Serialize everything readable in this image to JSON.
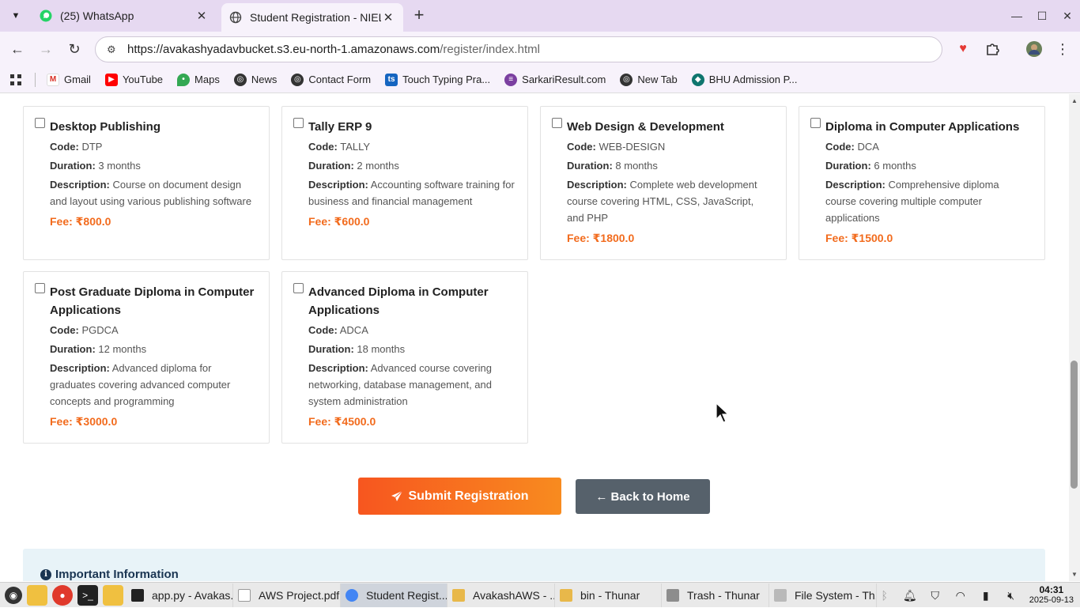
{
  "tabs": [
    {
      "title": "(25) WhatsApp",
      "close": "✕",
      "icon": "whatsapp-icon"
    },
    {
      "title": "Student Registration - NIELIT",
      "close": "✕",
      "icon": "globe-icon"
    }
  ],
  "toolbar": {
    "url_main": "https://avakashyadavbucket.s3.eu-north-1.amazonaws.com",
    "url_path": "/register/index.html"
  },
  "bookmarks": [
    {
      "label": "Gmail",
      "icon": "gmail-icon"
    },
    {
      "label": "YouTube",
      "icon": "youtube-icon"
    },
    {
      "label": "Maps",
      "icon": "maps-icon"
    },
    {
      "label": "News",
      "icon": "globe-icon"
    },
    {
      "label": "Contact Form",
      "icon": "globe-icon"
    },
    {
      "label": "Touch Typing Pra...",
      "icon": "typing-icon"
    },
    {
      "label": "SarkariResult.com",
      "icon": "sarkari-icon"
    },
    {
      "label": "New Tab",
      "icon": "globe-icon"
    },
    {
      "label": "BHU Admission P...",
      "icon": "bhu-icon"
    }
  ],
  "labels": {
    "code": "Code:",
    "duration": "Duration:",
    "description": "Description:"
  },
  "courses": [
    {
      "name": "Desktop Publishing",
      "code": "DTP",
      "duration": "3 months",
      "description": "Course on document design and layout using various publishing software",
      "fee": "Fee: ₹800.0"
    },
    {
      "name": "Tally ERP 9",
      "code": "TALLY",
      "duration": "2 months",
      "description": "Accounting software training for business and financial management",
      "fee": "Fee: ₹600.0"
    },
    {
      "name": "Web Design & Development",
      "code": "WEB-DESIGN",
      "duration": "8 months",
      "description": "Complete web development course covering HTML, CSS, JavaScript, and PHP",
      "fee": "Fee: ₹1800.0"
    },
    {
      "name": "Diploma in Computer Applications",
      "code": "DCA",
      "duration": "6 months",
      "description": "Comprehensive diploma course covering multiple computer applications",
      "fee": "Fee: ₹1500.0"
    },
    {
      "name": "Post Graduate Diploma in Computer Applications",
      "code": "PGDCA",
      "duration": "12 months",
      "description": "Advanced diploma for graduates covering advanced computer concepts and programming",
      "fee": "Fee: ₹3000.0"
    },
    {
      "name": "Advanced Diploma in Computer Applications",
      "code": "ADCA",
      "duration": "18 months",
      "description": "Advanced course covering networking, database management, and system administration",
      "fee": "Fee: ₹4500.0"
    }
  ],
  "buttons": {
    "submit": "Submit Registration",
    "back": "← Back to Home"
  },
  "info": {
    "heading": "Important Information"
  },
  "taskbar": {
    "tasks": [
      {
        "label": "app.py - Avakas...",
        "color": "#222222"
      },
      {
        "label": "AWS Project.pdf",
        "color": "#ffffff"
      },
      {
        "label": "Student Regist...",
        "color": "#4285f4"
      },
      {
        "label": "AvakashAWS - ...",
        "color": "#e8b84a"
      },
      {
        "label": "bin - Thunar",
        "color": "#e8b84a"
      },
      {
        "label": "Trash - Thunar",
        "color": "#8d8d8d"
      },
      {
        "label": "File System - Th...",
        "color": "#b9b9b9"
      }
    ],
    "time": "04:31",
    "date": "2025-09-13"
  }
}
